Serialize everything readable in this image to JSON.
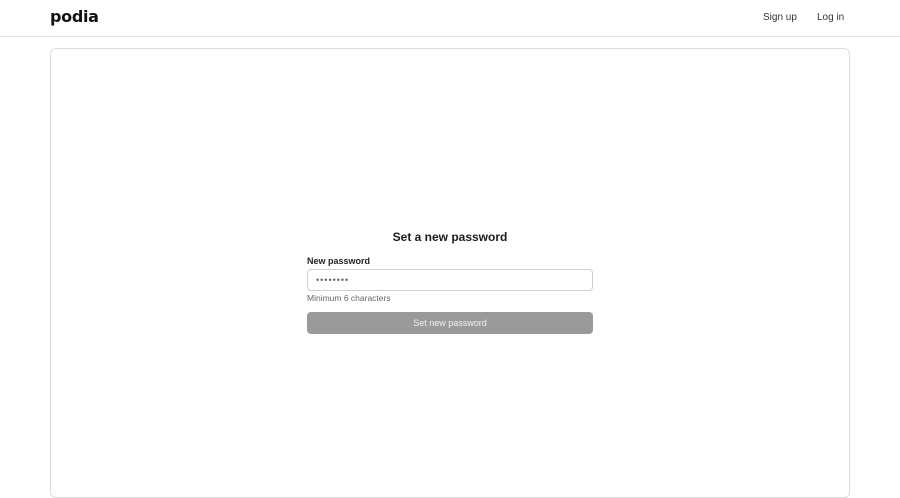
{
  "header": {
    "logo": "podia",
    "nav": {
      "sign_up": "Sign up",
      "log_in": "Log in"
    }
  },
  "form": {
    "title": "Set a new password",
    "password_label": "New password",
    "password_placeholder": "••••••••",
    "password_value": "",
    "hint": "Minimum 6 characters",
    "submit_label": "Set new password",
    "submit_state": "disabled"
  },
  "colors": {
    "button_disabled": "#9a9a9a",
    "border": "#dcdcdc",
    "text": "#1b1b1b"
  }
}
